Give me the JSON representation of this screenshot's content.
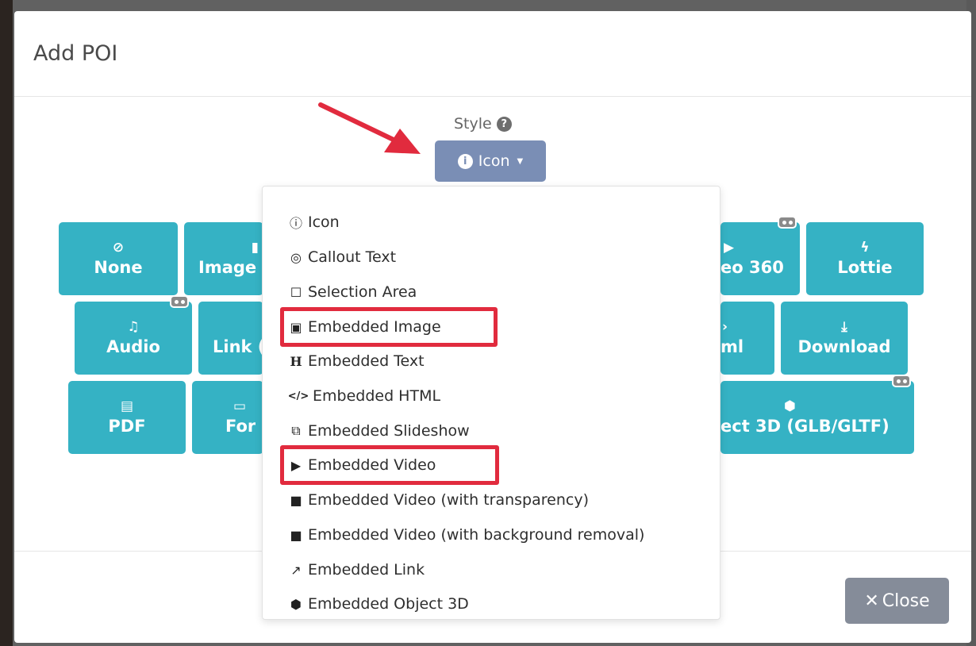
{
  "modal": {
    "title": "Add POI"
  },
  "style": {
    "label": "Style",
    "button_label": "Icon"
  },
  "tiles": [
    {
      "label": "None",
      "icon": "ban-icon"
    },
    {
      "label": "Image",
      "icon": "image-icon"
    },
    {
      "label": "eo 360",
      "icon": "video-icon",
      "vr": true
    },
    {
      "label": "Lottie",
      "icon": "lottie-icon"
    },
    {
      "label": "Audio",
      "icon": "music-icon",
      "vr": true
    },
    {
      "label": "Link (",
      "icon": "link-icon"
    },
    {
      "label": "ml",
      "icon": "code-icon"
    },
    {
      "label": "Download",
      "icon": "download-icon"
    },
    {
      "label": "PDF",
      "icon": "pdf-icon"
    },
    {
      "label": "For",
      "icon": "form-icon"
    },
    {
      "label": "ect 3D (GLB/GLTF)",
      "icon": "cube-icon",
      "vr": true
    }
  ],
  "dropdown": {
    "items": [
      {
        "label": "Icon",
        "icon": "info-icon"
      },
      {
        "label": "Callout Text",
        "icon": "bullseye-icon"
      },
      {
        "label": "Selection Area",
        "icon": "square-icon"
      },
      {
        "label": "Embedded Image",
        "icon": "image-icon",
        "highlighted": true
      },
      {
        "label": "Embedded Text",
        "icon": "heading-icon"
      },
      {
        "label": "Embedded HTML",
        "icon": "code-icon"
      },
      {
        "label": "Embedded Slideshow",
        "icon": "images-icon"
      },
      {
        "label": "Embedded Video",
        "icon": "youtube-icon",
        "highlighted": true
      },
      {
        "label": "Embedded Video (with transparency)",
        "icon": "video-camera-icon"
      },
      {
        "label": "Embedded Video (with background removal)",
        "icon": "video-camera-icon"
      },
      {
        "label": "Embedded Link",
        "icon": "external-link-icon"
      },
      {
        "label": "Embedded Object 3D",
        "icon": "cube-icon"
      }
    ]
  },
  "footer": {
    "close_label": "Close"
  },
  "colors": {
    "tile": "#35b2c4",
    "style_button": "#7a8eb5",
    "highlight": "#e12b3e",
    "close_button": "#858c99",
    "arrow": "#e12b3e"
  }
}
